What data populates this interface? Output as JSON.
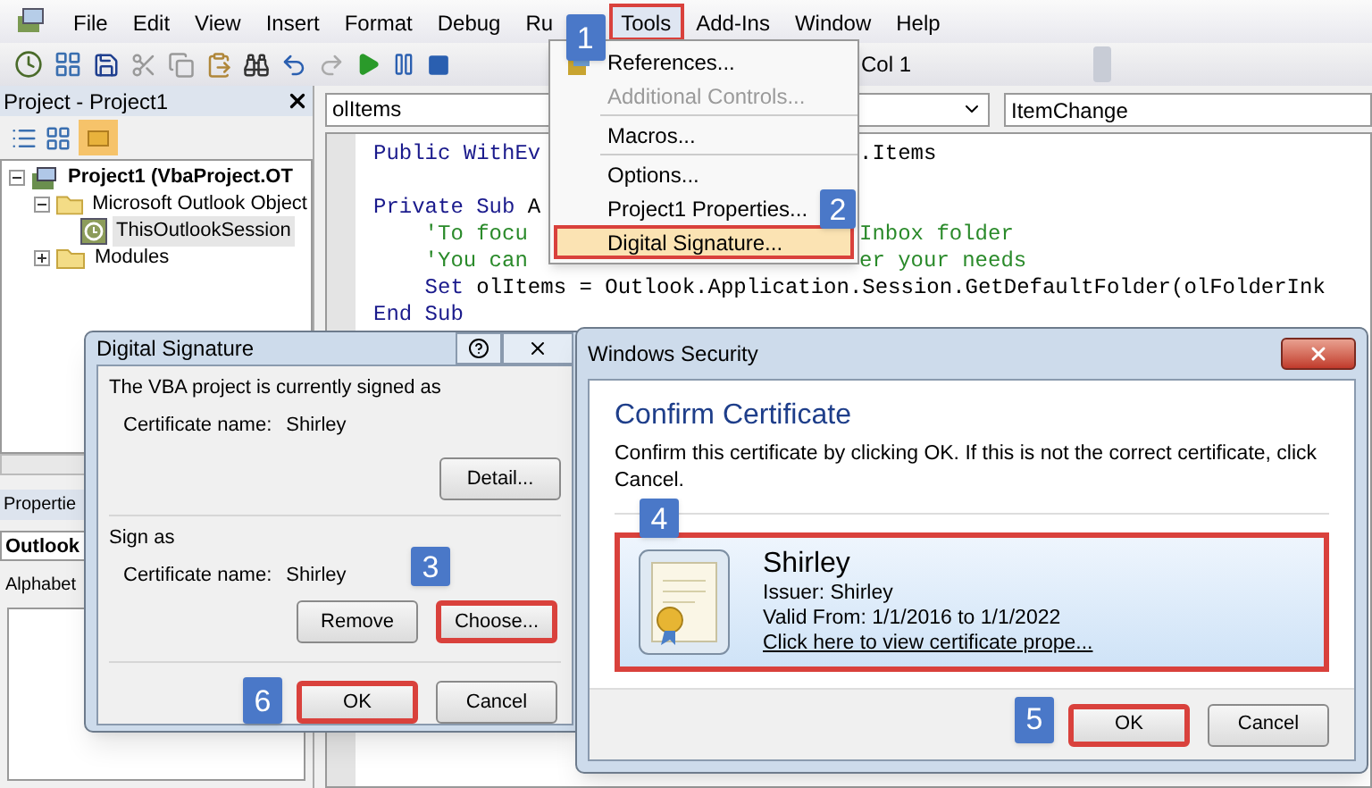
{
  "menu_bar": {
    "items": [
      {
        "label": "File",
        "selected": false,
        "highlighted": false
      },
      {
        "label": "Edit",
        "selected": false,
        "highlighted": false
      },
      {
        "label": "View",
        "selected": false,
        "highlighted": false
      },
      {
        "label": "Insert",
        "selected": false,
        "highlighted": false
      },
      {
        "label": "Format",
        "selected": false,
        "highlighted": false
      },
      {
        "label": "Debug",
        "selected": false,
        "highlighted": false
      },
      {
        "label": "Ru",
        "selected": false,
        "highlighted": false
      },
      {
        "label": "Tools",
        "selected": true,
        "highlighted": true,
        "step": "1"
      },
      {
        "label": "Add-Ins",
        "selected": false,
        "highlighted": false
      },
      {
        "label": "Window",
        "selected": false,
        "highlighted": false
      },
      {
        "label": "Help",
        "selected": false,
        "highlighted": false
      }
    ]
  },
  "toolbar": {
    "position": "Col 1"
  },
  "project_panel": {
    "title": "Project - Project1",
    "tree": [
      {
        "label": "Project1 (VbaProject.OT",
        "kind": "project",
        "expanded": true,
        "selected": false,
        "children": [
          {
            "label": "Microsoft Outlook Object",
            "kind": "folder",
            "expanded": true,
            "selected": false,
            "children": [
              {
                "label": "ThisOutlookSession",
                "kind": "module",
                "selected": true
              }
            ]
          },
          {
            "label": "Modules",
            "kind": "folder",
            "expanded": false,
            "selected": false
          }
        ]
      }
    ]
  },
  "properties_panel": {
    "title": "Propertie",
    "object": "Outlook",
    "tab": "Alphabet"
  },
  "code_window": {
    "object": "olItems",
    "procedure": "ItemChange",
    "lines": [
      {
        "kind": "code",
        "left": [
          {
            "text": "Public WithEv",
            "kind": "keyword"
          }
        ],
        "right": [
          {
            "text": ".Items",
            "kind": "plain"
          }
        ]
      },
      {
        "kind": "blank"
      },
      {
        "kind": "code",
        "left": [
          {
            "text": "Private Sub",
            "kind": "keyword"
          },
          {
            "text": " A",
            "kind": "plain"
          }
        ]
      },
      {
        "kind": "code",
        "left": [
          {
            "text": "    'To focu",
            "kind": "comment"
          }
        ],
        "right": [
          {
            "text": "Inbox folder",
            "kind": "comment"
          }
        ]
      },
      {
        "kind": "code",
        "left": [
          {
            "text": "    'You can",
            "kind": "comment"
          }
        ],
        "right": [
          {
            "text": "er your needs",
            "kind": "comment"
          }
        ]
      },
      {
        "kind": "code",
        "left": [
          {
            "text": "    Set",
            "kind": "keyword"
          },
          {
            "text": " olItems = Outlook.Application.Session.GetDefaultFolder(olFolderInk",
            "kind": "plain"
          }
        ]
      },
      {
        "kind": "code",
        "left": [
          {
            "text": "End Sub",
            "kind": "keyword"
          }
        ]
      }
    ]
  },
  "tools_menu": {
    "items": [
      {
        "label": "References...",
        "disabled": false,
        "highlighted": false,
        "separator_after": false
      },
      {
        "label": "Additional Controls...",
        "disabled": true,
        "highlighted": false,
        "separator_after": true
      },
      {
        "label": "Macros...",
        "disabled": false,
        "highlighted": false,
        "separator_after": true
      },
      {
        "label": "Options...",
        "disabled": false,
        "highlighted": false,
        "separator_after": false
      },
      {
        "label": "Project1 Properties...",
        "disabled": false,
        "highlighted": false,
        "separator_after": false,
        "step_beside": "2"
      },
      {
        "label": "Digital Signature...",
        "disabled": false,
        "highlighted": true,
        "separator_after": false
      }
    ]
  },
  "digital_signature_dialog": {
    "title": "Digital Signature",
    "current_heading": "The VBA project is currently signed as",
    "current_label": "Certificate name:",
    "current_value": "Shirley",
    "detail_button": "Detail...",
    "sign_heading": "Sign as",
    "sign_label": "Certificate name:",
    "sign_value": "Shirley",
    "buttons": [
      {
        "label": "Remove",
        "kind": "remove",
        "highlighted": false
      },
      {
        "label": "Choose...",
        "kind": "choose",
        "highlighted": true,
        "step": "3"
      },
      {
        "label": "OK",
        "kind": "ok",
        "highlighted": true,
        "step": "6"
      },
      {
        "label": "Cancel",
        "kind": "cancel",
        "highlighted": false
      }
    ]
  },
  "security_dialog": {
    "title": "Windows Security",
    "heading": "Confirm Certificate",
    "message": "Confirm this certificate by clicking OK. If this is not the correct certificate, click Cancel.",
    "certificate": {
      "name": "Shirley",
      "issuer": "Issuer: Shirley",
      "validity": "Valid From: 1/1/2016 to 1/1/2022",
      "link": "Click here to view certificate prope...",
      "highlighted": true,
      "step": "4"
    },
    "buttons": [
      {
        "label": "OK",
        "highlighted": true,
        "step": "5"
      },
      {
        "label": "Cancel",
        "highlighted": false
      }
    ]
  }
}
